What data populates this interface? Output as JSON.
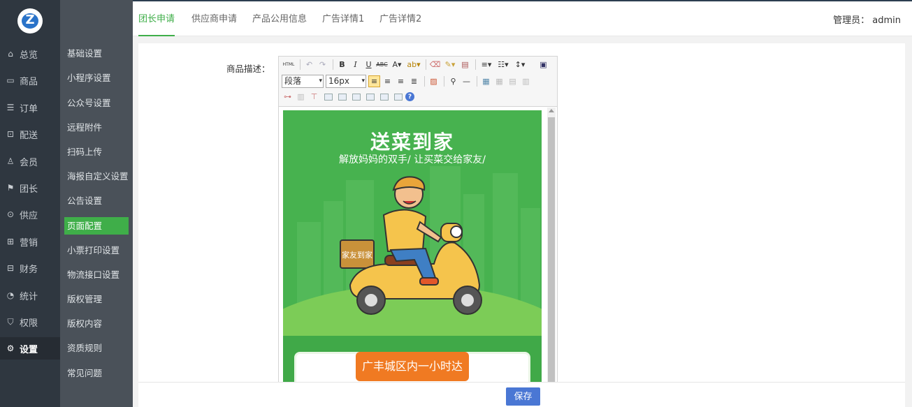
{
  "logo_letter": "Z",
  "rail": [
    {
      "icon": "home-icon",
      "label": "总览"
    },
    {
      "icon": "shop-icon",
      "label": "商品"
    },
    {
      "icon": "order-icon",
      "label": "订单"
    },
    {
      "icon": "delivery-icon",
      "label": "配送"
    },
    {
      "icon": "user-icon",
      "label": "会员"
    },
    {
      "icon": "group-leader-icon",
      "label": "团长"
    },
    {
      "icon": "supply-icon",
      "label": "供应"
    },
    {
      "icon": "gift-icon",
      "label": "营销"
    },
    {
      "icon": "finance-icon",
      "label": "财务"
    },
    {
      "icon": "stats-icon",
      "label": "统计"
    },
    {
      "icon": "shield-icon",
      "label": "权限"
    },
    {
      "icon": "gear-icon",
      "label": "设置"
    }
  ],
  "submenu": [
    "基础设置",
    "小程序设置",
    "公众号设置",
    "远程附件",
    "扫码上传",
    "海报自定义设置",
    "公告设置",
    "页面配置",
    "小票打印设置",
    "物流接口设置",
    "版权管理",
    "版权内容",
    "资质规则",
    "常见问题"
  ],
  "tabs": [
    "团长申请",
    "供应商申请",
    "产品公用信息",
    "广告详情1",
    "广告详情2"
  ],
  "admin_text": "管理员： admin",
  "form": {
    "label": "商品描述："
  },
  "editor": {
    "html_btn": "HTML",
    "paragraph": "段落",
    "fontsize": "16px"
  },
  "poster": {
    "title": "送菜到家",
    "subtitle": "解放妈妈的双手/ 让买菜交给家友/",
    "box_text": "家友到家",
    "badge": "广丰城区内一小时达"
  },
  "save_label": "保存",
  "colors": {
    "accent": "#3fae49",
    "save": "#4a77d4",
    "rail": "#2f3740",
    "submenu": "#4a5159"
  }
}
